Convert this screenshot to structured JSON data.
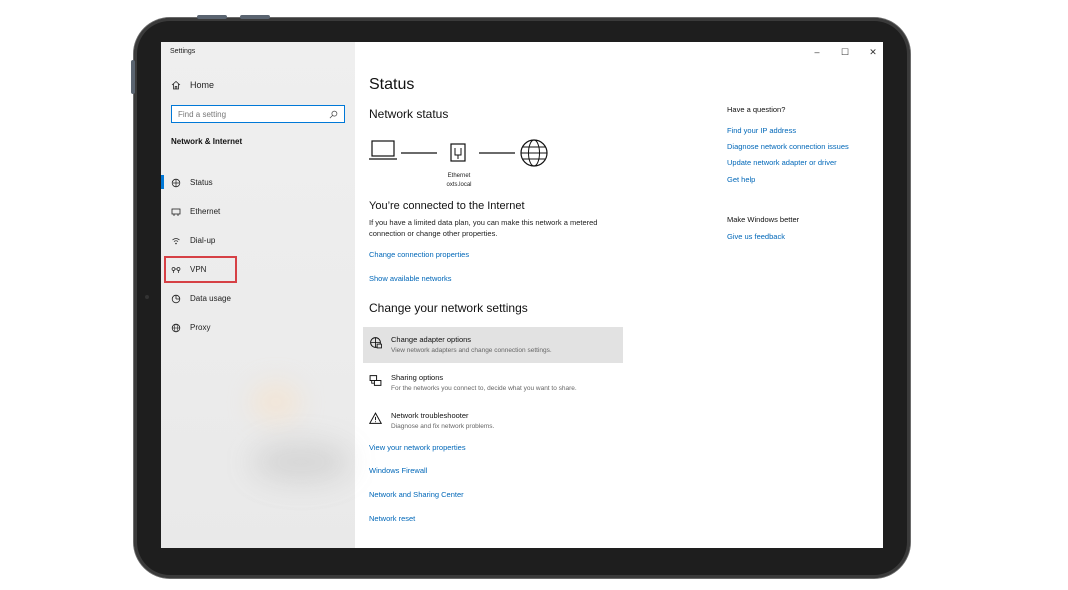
{
  "window": {
    "app_title": "Settings",
    "controls": {
      "minimize": "–",
      "maximize": "☐",
      "close": "✕"
    }
  },
  "sidebar": {
    "home_label": "Home",
    "search_placeholder": "Find a setting",
    "section_title": "Network & Internet",
    "items": [
      {
        "label": "Status",
        "icon": "status-icon",
        "active": true
      },
      {
        "label": "Ethernet",
        "icon": "ethernet-icon"
      },
      {
        "label": "Dial-up",
        "icon": "dialup-icon"
      },
      {
        "label": "VPN",
        "icon": "vpn-icon",
        "highlighted": true
      },
      {
        "label": "Data usage",
        "icon": "data-usage-icon"
      },
      {
        "label": "Proxy",
        "icon": "proxy-icon"
      }
    ]
  },
  "main": {
    "title": "Status",
    "network_status_heading": "Network status",
    "diagram": {
      "adapter_name": "Ethernet",
      "network_name": "oxts.local"
    },
    "connected_heading": "You’re connected to the Internet",
    "connected_desc": "If you have a limited data plan, you can make this network a metered connection or change other properties.",
    "links_top": [
      "Change connection properties",
      "Show available networks"
    ],
    "change_settings_heading": "Change your network settings",
    "options": [
      {
        "title": "Change adapter options",
        "subtitle": "View network adapters and change connection settings.",
        "icon": "adapter-icon"
      },
      {
        "title": "Sharing options",
        "subtitle": "For the networks you connect to, decide what you want to share.",
        "icon": "sharing-icon"
      },
      {
        "title": "Network troubleshooter",
        "subtitle": "Diagnose and fix network problems.",
        "icon": "warning-icon"
      }
    ],
    "links_bottom": [
      "View your network properties",
      "Windows Firewall",
      "Network and Sharing Center",
      "Network reset"
    ]
  },
  "right_panel": {
    "question_heading": "Have a question?",
    "question_links": [
      "Find your IP address",
      "Diagnose network connection issues",
      "Update network adapter or driver",
      "Get help"
    ],
    "better_heading": "Make Windows better",
    "better_link": "Give us feedback"
  },
  "colors": {
    "accent": "#0078d7",
    "link": "#0067b8",
    "highlight_box": "#d64045",
    "sidebar_bg": "#ececec"
  }
}
